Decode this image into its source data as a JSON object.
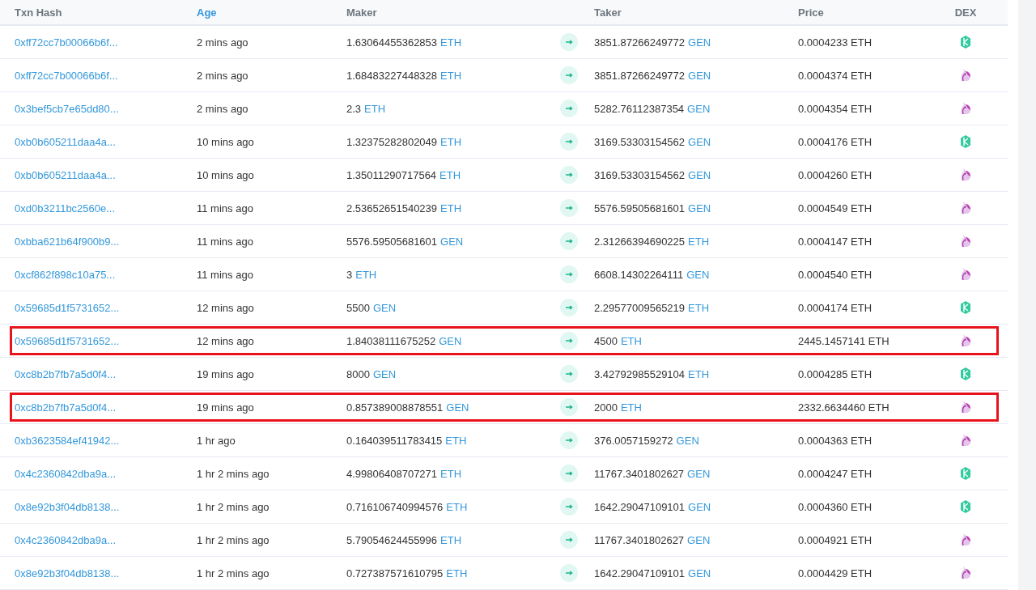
{
  "columns": [
    {
      "label": "Txn Hash",
      "kind": "text"
    },
    {
      "label": "Age",
      "kind": "link"
    },
    {
      "label": "Maker",
      "kind": "text"
    },
    {
      "label": "Taker",
      "kind": "text"
    },
    {
      "label": "Price",
      "kind": "text"
    },
    {
      "label": "DEX",
      "kind": "text"
    }
  ],
  "rows": [
    {
      "hash": "0xff72cc7b00066b6f...",
      "age": "2 mins ago",
      "maker": {
        "amount": "1.63064455362853",
        "token": "ETH"
      },
      "taker": {
        "amount": "3851.87266249772",
        "token": "GEN"
      },
      "price": "0.0004233 ETH",
      "dex": {
        "kind": "kyber"
      },
      "highlighted": false
    },
    {
      "hash": "0xff72cc7b00066b6f...",
      "age": "2 mins ago",
      "maker": {
        "amount": "1.68483227448328",
        "token": "ETH"
      },
      "taker": {
        "amount": "3851.87266249772",
        "token": "GEN"
      },
      "price": "0.0004374 ETH",
      "dex": {
        "kind": "uniswap"
      },
      "highlighted": false
    },
    {
      "hash": "0x3bef5cb7e65dd80...",
      "age": "2 mins ago",
      "maker": {
        "amount": "2.3",
        "token": "ETH"
      },
      "taker": {
        "amount": "5282.76112387354",
        "token": "GEN"
      },
      "price": "0.0004354 ETH",
      "dex": {
        "kind": "uniswap"
      },
      "highlighted": false
    },
    {
      "hash": "0xb0b605211daa4a...",
      "age": "10 mins ago",
      "maker": {
        "amount": "1.32375282802049",
        "token": "ETH"
      },
      "taker": {
        "amount": "3169.53303154562",
        "token": "GEN"
      },
      "price": "0.0004176 ETH",
      "dex": {
        "kind": "kyber"
      },
      "highlighted": false
    },
    {
      "hash": "0xb0b605211daa4a...",
      "age": "10 mins ago",
      "maker": {
        "amount": "1.35011290717564",
        "token": "ETH"
      },
      "taker": {
        "amount": "3169.53303154562",
        "token": "GEN"
      },
      "price": "0.0004260 ETH",
      "dex": {
        "kind": "uniswap"
      },
      "highlighted": false
    },
    {
      "hash": "0xd0b3211bc2560e...",
      "age": "11 mins ago",
      "maker": {
        "amount": "2.53652651540239",
        "token": "ETH"
      },
      "taker": {
        "amount": "5576.59505681601",
        "token": "GEN"
      },
      "price": "0.0004549 ETH",
      "dex": {
        "kind": "uniswap"
      },
      "highlighted": false
    },
    {
      "hash": "0xbba621b64f900b9...",
      "age": "11 mins ago",
      "maker": {
        "amount": "5576.59505681601",
        "token": "GEN"
      },
      "taker": {
        "amount": "2.31266394690225",
        "token": "ETH"
      },
      "price": "0.0004147 ETH",
      "dex": {
        "kind": "uniswap"
      },
      "highlighted": false
    },
    {
      "hash": "0xcf862f898c10a75...",
      "age": "11 mins ago",
      "maker": {
        "amount": "3",
        "token": "ETH"
      },
      "taker": {
        "amount": "6608.14302264111",
        "token": "GEN"
      },
      "price": "0.0004540 ETH",
      "dex": {
        "kind": "uniswap"
      },
      "highlighted": false
    },
    {
      "hash": "0x59685d1f5731652...",
      "age": "12 mins ago",
      "maker": {
        "amount": "5500",
        "token": "GEN"
      },
      "taker": {
        "amount": "2.29577009565219",
        "token": "ETH"
      },
      "price": "0.0004174 ETH",
      "dex": {
        "kind": "kyber"
      },
      "highlighted": false
    },
    {
      "hash": "0x59685d1f5731652...",
      "age": "12 mins ago",
      "maker": {
        "amount": "1.84038111675252",
        "token": "GEN"
      },
      "taker": {
        "amount": "4500",
        "token": "ETH"
      },
      "price": "2445.1457141 ETH",
      "dex": {
        "kind": "uniswap"
      },
      "highlighted": true
    },
    {
      "hash": "0xc8b2b7fb7a5d0f4...",
      "age": "19 mins ago",
      "maker": {
        "amount": "8000",
        "token": "GEN"
      },
      "taker": {
        "amount": "3.42792985529104",
        "token": "ETH"
      },
      "price": "0.0004285 ETH",
      "dex": {
        "kind": "kyber"
      },
      "highlighted": false
    },
    {
      "hash": "0xc8b2b7fb7a5d0f4...",
      "age": "19 mins ago",
      "maker": {
        "amount": "0.857389008878551",
        "token": "GEN"
      },
      "taker": {
        "amount": "2000",
        "token": "ETH"
      },
      "price": "2332.6634460 ETH",
      "dex": {
        "kind": "uniswap"
      },
      "highlighted": true
    },
    {
      "hash": "0xb3623584ef41942...",
      "age": "1 hr ago",
      "maker": {
        "amount": "0.164039511783415",
        "token": "ETH"
      },
      "taker": {
        "amount": "376.0057159272",
        "token": "GEN"
      },
      "price": "0.0004363 ETH",
      "dex": {
        "kind": "uniswap"
      },
      "highlighted": false
    },
    {
      "hash": "0x4c2360842dba9a...",
      "age": "1 hr 2 mins ago",
      "maker": {
        "amount": "4.99806408707271",
        "token": "ETH"
      },
      "taker": {
        "amount": "11767.3401802627",
        "token": "GEN"
      },
      "price": "0.0004247 ETH",
      "dex": {
        "kind": "kyber"
      },
      "highlighted": false
    },
    {
      "hash": "0x8e92b3f04db8138...",
      "age": "1 hr 2 mins ago",
      "maker": {
        "amount": "0.716106740994576",
        "token": "ETH"
      },
      "taker": {
        "amount": "1642.29047109101",
        "token": "GEN"
      },
      "price": "0.0004360 ETH",
      "dex": {
        "kind": "kyber"
      },
      "highlighted": false
    },
    {
      "hash": "0x4c2360842dba9a...",
      "age": "1 hr 2 mins ago",
      "maker": {
        "amount": "5.79054624455996",
        "token": "ETH"
      },
      "taker": {
        "amount": "11767.3401802627",
        "token": "GEN"
      },
      "price": "0.0004921 ETH",
      "dex": {
        "kind": "uniswap"
      },
      "highlighted": false
    },
    {
      "hash": "0x8e92b3f04db8138...",
      "age": "1 hr 2 mins ago",
      "maker": {
        "amount": "0.727387571610795",
        "token": "ETH"
      },
      "taker": {
        "amount": "1642.29047109101",
        "token": "GEN"
      },
      "price": "0.0004429 ETH",
      "dex": {
        "kind": "uniswap"
      },
      "highlighted": false
    }
  ]
}
